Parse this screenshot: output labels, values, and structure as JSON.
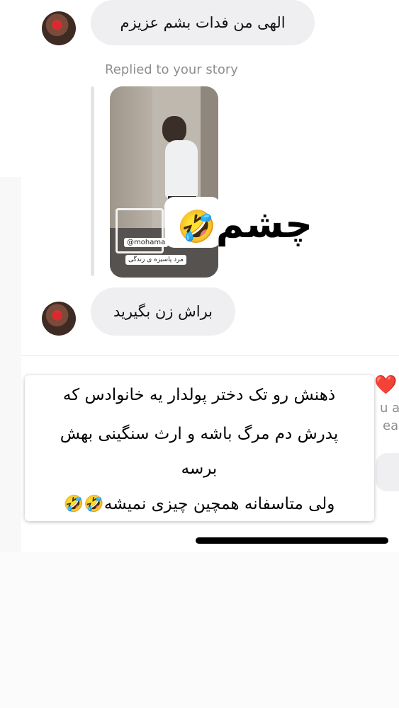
{
  "thread": {
    "message_1": "الهی من فدات بشم عزیزم",
    "reply_label": "Replied to your story",
    "story": {
      "handle": "@mohama",
      "caption": "مرد پاسیزه ی زندگی",
      "sticker_text": "چشم",
      "sticker_emoji": "🤣"
    },
    "message_2": "براش زن بگیرید",
    "reaction_emoji": "❤️",
    "cut_text_1": "u and",
    "cut_text_2": "ead"
  },
  "overlay_note": {
    "line_1": "ذهنش رو تک دختر پولدار یه خانوادس که",
    "line_2": "پدرش دم مرگ باشه و ارث سنگینی بهش",
    "line_3": "برسه",
    "line_4": "ولی متاسفانه همچین چیزی نمیشه",
    "line_4_emojis": "🤣🤣"
  },
  "icons": {
    "avatar_heart": "heart-icon",
    "reaction": "red-heart-icon"
  },
  "colors": {
    "bubble_bg": "#efeff1",
    "label_gray": "#8e8e8e",
    "heart_red": "#e0262e"
  }
}
